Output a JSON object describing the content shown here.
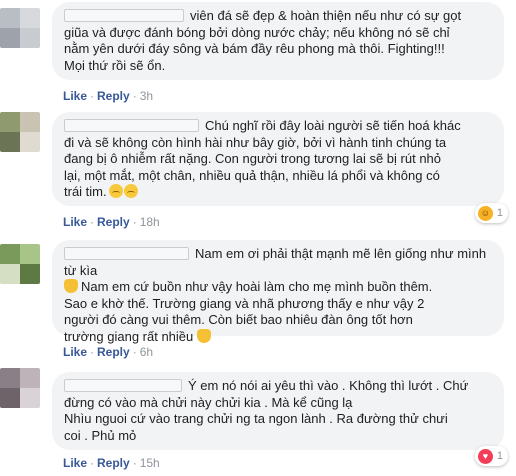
{
  "actions": {
    "like": "Like",
    "reply": "Reply",
    "dot": "·"
  },
  "comments": [
    {
      "lines": [
        "viên đá sẽ đẹp & hoàn thiện nếu như có sự gọt",
        "giũa và được đánh bóng bởi dòng nước chảy; nếu không nó sẽ chỉ",
        "nằm yên dưới đáy sông và bám đầy rêu phong mà thôi. Fighting!!!",
        "Mọi thứ rồi sẽ ổn."
      ],
      "time": "3h",
      "avatar_colors": [
        "#b9bdc4",
        "#d7d9dd",
        "#9ea3ab",
        "#c8cbd0"
      ]
    },
    {
      "lines": [
        "Chú nghĩ rồi đây loài người sẽ tiến hoá khác",
        "đi và sẽ không còn hình hài như bây giờ, bởi vì hành tinh chúng ta",
        "đang bị ô nhiễm rất nặng. Con người trong tương lai sẽ bị rút nhỏ",
        "lại, một mắt, một chân, nhiều quả thận, nhiều lá phổi và không có",
        "trái tim."
      ],
      "time": "18h",
      "reaction_count": "1",
      "reaction_icon": "haha-icon",
      "avatar_colors": [
        "#8f9a6e",
        "#c9c3b4",
        "#6c7456",
        "#e0dbd0"
      ]
    },
    {
      "lines": [
        "Nam em ơi phải thật mạnh mẽ lên giống như mình từ kìa",
        "Nam em cứ buồn như vậy hoài làm cho mẹ mình buồn thêm.",
        "Sao e khờ thế. Trường giang và nhã phương thấy e như vậy 2",
        "người đó càng vui thêm. Còn biết bao nhiêu đàn ông tốt hơn",
        "trường giang rất nhiều"
      ],
      "time": "6h",
      "avatar_colors": [
        "#7a9a5c",
        "#a9c487",
        "#d4dfc4",
        "#5d7a44"
      ]
    },
    {
      "lines": [
        "Ý em nó nói ai yêu thì vào . Không thì lướt . Chứ",
        "đừng có vào mà chửi này chửi kia . Mà kể cũng lạ",
        "Nhìu nguoi cứ vào trang chửi ng ta ngon lành . Ra đường thử chưi",
        "coi . Phủ mỏ"
      ],
      "time": "15h",
      "reaction_count": "1",
      "reaction_icon": "love-icon",
      "avatar_colors": [
        "#8a7f86",
        "#bdb3b9",
        "#6d6369",
        "#d9d2d6"
      ]
    }
  ],
  "colors": {
    "link": "#385898",
    "meta": "#90949c",
    "bubble": "#f2f3f5",
    "haha": "#f7b125",
    "love": "#f33e58"
  }
}
